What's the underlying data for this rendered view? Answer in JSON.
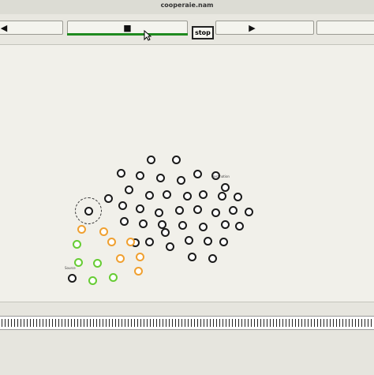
{
  "window": {
    "title": "cooperaie.nam"
  },
  "toolbar": {
    "rewind_glyph": "◀",
    "stop_glyph": "■",
    "stop_label": "stop",
    "play_glyph": "▶",
    "progress": 1.0
  },
  "canvas": {
    "source_label": "Source",
    "destination_label": "Destination",
    "nodes": [
      {
        "c": "black"
      },
      {
        "c": "black"
      },
      {
        "c": "black"
      },
      {
        "c": "black"
      },
      {
        "c": "black"
      },
      {
        "c": "black"
      },
      {
        "c": "black"
      },
      {
        "c": "black"
      },
      {
        "c": "black"
      },
      {
        "c": "black"
      },
      {
        "c": "black"
      },
      {
        "c": "black"
      },
      {
        "c": "black"
      },
      {
        "c": "black"
      },
      {
        "c": "black"
      },
      {
        "c": "black"
      },
      {
        "c": "black"
      },
      {
        "c": "black"
      },
      {
        "c": "black"
      },
      {
        "c": "black"
      },
      {
        "c": "black"
      },
      {
        "c": "black"
      },
      {
        "c": "black"
      },
      {
        "c": "black"
      },
      {
        "c": "black"
      },
      {
        "c": "black"
      },
      {
        "c": "black"
      },
      {
        "c": "black"
      },
      {
        "c": "black"
      },
      {
        "c": "black"
      },
      {
        "c": "black"
      },
      {
        "c": "black"
      },
      {
        "c": "black"
      },
      {
        "c": "black"
      },
      {
        "c": "black"
      },
      {
        "c": "black"
      },
      {
        "c": "black"
      },
      {
        "c": "black"
      },
      {
        "c": "black"
      },
      {
        "c": "black"
      },
      {
        "c": "black"
      },
      {
        "c": "orange"
      },
      {
        "c": "orange"
      },
      {
        "c": "orange"
      },
      {
        "c": "orange"
      },
      {
        "c": "orange"
      },
      {
        "c": "orange"
      },
      {
        "c": "orange"
      },
      {
        "c": "green"
      },
      {
        "c": "green"
      },
      {
        "c": "green"
      },
      {
        "c": "green"
      },
      {
        "c": "green"
      },
      {
        "c": "black"
      }
    ]
  }
}
